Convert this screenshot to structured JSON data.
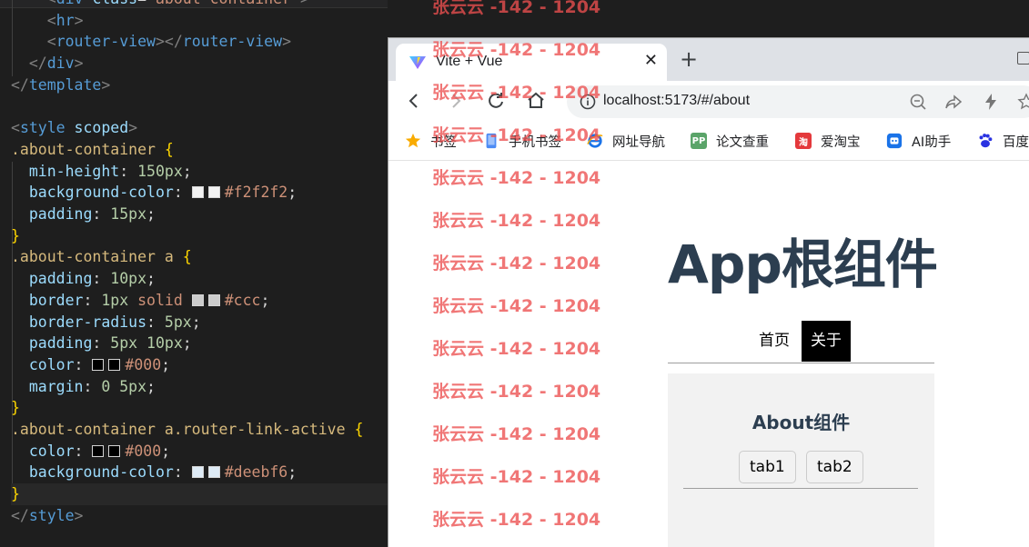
{
  "editor": {
    "lines": [
      {
        "id": "l0",
        "indent": "    ",
        "text": "<div class=\"about-container\">"
      },
      {
        "id": "l1",
        "parts": [
          [
            "    ",
            "t-text"
          ],
          [
            "<",
            "t-punct"
          ],
          [
            "hr",
            "t-tag"
          ],
          [
            ">",
            "t-punct"
          ]
        ]
      },
      {
        "id": "l2",
        "parts": [
          [
            "    ",
            "t-text"
          ],
          [
            "<",
            "t-punct"
          ],
          [
            "router-view",
            "t-tag"
          ],
          [
            "></",
            "t-punct"
          ],
          [
            "router-view",
            "t-tag"
          ],
          [
            ">",
            "t-punct"
          ]
        ]
      },
      {
        "id": "l3",
        "parts": [
          [
            "  ",
            "t-text"
          ],
          [
            "</",
            "t-punct"
          ],
          [
            "div",
            "t-tag"
          ],
          [
            ">",
            "t-punct"
          ]
        ]
      },
      {
        "id": "l4",
        "parts": [
          [
            "</",
            "t-punct"
          ],
          [
            "template",
            "t-tag"
          ],
          [
            ">",
            "t-punct"
          ]
        ]
      },
      {
        "id": "l5",
        "parts": []
      },
      {
        "id": "l6",
        "parts": [
          [
            "<",
            "t-punct"
          ],
          [
            "style",
            "t-tag"
          ],
          [
            " ",
            "t-text"
          ],
          [
            "scoped",
            "t-attr"
          ],
          [
            ">",
            "t-punct"
          ]
        ]
      },
      {
        "id": "l7",
        "parts": [
          [
            ".about-container",
            "t-sel"
          ],
          [
            " ",
            "t-text"
          ],
          [
            "{",
            "t-brace"
          ]
        ]
      },
      {
        "id": "l8",
        "parts": [
          [
            "  ",
            "t-text"
          ],
          [
            "min-height",
            "t-prop"
          ],
          [
            ": ",
            "t-text"
          ],
          [
            "150px",
            "t-num"
          ],
          [
            ";",
            "t-text"
          ]
        ]
      },
      {
        "id": "l9",
        "parts": [
          [
            "  ",
            "t-text"
          ],
          [
            "background-color",
            "t-prop"
          ],
          [
            ": ",
            "t-text"
          ],
          [
            "#f2f2f2",
            "swatch"
          ],
          [
            "#f2f2f2",
            "t-str"
          ],
          [
            ";",
            "t-text"
          ]
        ]
      },
      {
        "id": "l10",
        "parts": [
          [
            "  ",
            "t-text"
          ],
          [
            "padding",
            "t-prop"
          ],
          [
            ": ",
            "t-text"
          ],
          [
            "15px",
            "t-num"
          ],
          [
            ";",
            "t-text"
          ]
        ]
      },
      {
        "id": "l11",
        "parts": [
          [
            "}",
            "t-brace"
          ]
        ]
      },
      {
        "id": "l12",
        "parts": [
          [
            ".about-container a",
            "t-sel"
          ],
          [
            " ",
            "t-text"
          ],
          [
            "{",
            "t-brace"
          ]
        ]
      },
      {
        "id": "l13",
        "parts": [
          [
            "  ",
            "t-text"
          ],
          [
            "padding",
            "t-prop"
          ],
          [
            ": ",
            "t-text"
          ],
          [
            "10px",
            "t-num"
          ],
          [
            ";",
            "t-text"
          ]
        ]
      },
      {
        "id": "l14",
        "parts": [
          [
            "  ",
            "t-text"
          ],
          [
            "border",
            "t-prop"
          ],
          [
            ": ",
            "t-text"
          ],
          [
            "1px",
            "t-num"
          ],
          [
            " ",
            "t-text"
          ],
          [
            "solid",
            "t-str"
          ],
          [
            " ",
            "t-text"
          ],
          [
            "#ccc",
            "swatch"
          ],
          [
            "#ccc",
            "t-str"
          ],
          [
            ";",
            "t-text"
          ]
        ]
      },
      {
        "id": "l15",
        "parts": [
          [
            "  ",
            "t-text"
          ],
          [
            "border-radius",
            "t-prop"
          ],
          [
            ": ",
            "t-text"
          ],
          [
            "5px",
            "t-num"
          ],
          [
            ";",
            "t-text"
          ]
        ]
      },
      {
        "id": "l16",
        "parts": [
          [
            "  ",
            "t-text"
          ],
          [
            "padding",
            "t-prop"
          ],
          [
            ": ",
            "t-text"
          ],
          [
            "5px 10px",
            "t-num"
          ],
          [
            ";",
            "t-text"
          ]
        ]
      },
      {
        "id": "l17",
        "parts": [
          [
            "  ",
            "t-text"
          ],
          [
            "color",
            "t-prop"
          ],
          [
            ": ",
            "t-text"
          ],
          [
            "#000",
            "swatch"
          ],
          [
            "#000",
            "t-str"
          ],
          [
            ";",
            "t-text"
          ]
        ]
      },
      {
        "id": "l18",
        "parts": [
          [
            "  ",
            "t-text"
          ],
          [
            "margin",
            "t-prop"
          ],
          [
            ": ",
            "t-text"
          ],
          [
            "0 5px",
            "t-num"
          ],
          [
            ";",
            "t-text"
          ]
        ]
      },
      {
        "id": "l19",
        "parts": [
          [
            "}",
            "t-brace"
          ]
        ]
      },
      {
        "id": "l20",
        "parts": [
          [
            ".about-container a.router-link-active",
            "t-sel"
          ],
          [
            " ",
            "t-text"
          ],
          [
            "{",
            "t-brace"
          ]
        ]
      },
      {
        "id": "l21",
        "parts": [
          [
            "  ",
            "t-text"
          ],
          [
            "color",
            "t-prop"
          ],
          [
            ": ",
            "t-text"
          ],
          [
            "#000",
            "swatch"
          ],
          [
            "#000",
            "t-str"
          ],
          [
            ";",
            "t-text"
          ]
        ]
      },
      {
        "id": "l22",
        "parts": [
          [
            "  ",
            "t-text"
          ],
          [
            "background-color",
            "t-prop"
          ],
          [
            ": ",
            "t-text"
          ],
          [
            "#deebf6",
            "swatch"
          ],
          [
            "#deebf6",
            "t-str"
          ],
          [
            ";",
            "t-text"
          ]
        ]
      },
      {
        "id": "l23",
        "parts": [
          [
            "}",
            "t-brace"
          ]
        ]
      },
      {
        "id": "l24",
        "parts": [
          [
            "</",
            "t-punct"
          ],
          [
            "style",
            "t-tag"
          ],
          [
            ">",
            "t-punct"
          ]
        ]
      }
    ]
  },
  "browser": {
    "tab_title": "Vite + Vue",
    "tab_close": "✕",
    "new_tab": "+",
    "url": "localhost:5173/#/about",
    "bookmarks": [
      {
        "label": "书签",
        "icon": "star-icon",
        "color": "#f9ab00"
      },
      {
        "label": "手机书签",
        "icon": "phone-icon",
        "color": "#4c8bf5"
      },
      {
        "label": "网址导航",
        "icon": "ie-icon",
        "color": "#1a73e8"
      },
      {
        "label": "论文查重",
        "icon": "pp-icon",
        "color": "#5aa469"
      },
      {
        "label": "爱淘宝",
        "icon": "taobao-icon",
        "color": "#e4393c"
      },
      {
        "label": "AI助手",
        "icon": "ai-icon",
        "color": "#1a73e8"
      },
      {
        "label": "百度",
        "icon": "baidu-icon",
        "color": "#2932e1"
      }
    ],
    "bookmark_badges": {
      "pp": "PP",
      "tb": "淘"
    }
  },
  "page": {
    "app_title": "App根组件",
    "nav": {
      "home": "首页",
      "about": "关于"
    },
    "about_title": "About组件",
    "tabs": [
      "tab1",
      "tab2"
    ]
  },
  "watermark": "张云云 -142 - 1204",
  "colors": {
    "accent": "#2c3e50",
    "active_link": "#000000",
    "about_bg": "#f2f2f2"
  }
}
